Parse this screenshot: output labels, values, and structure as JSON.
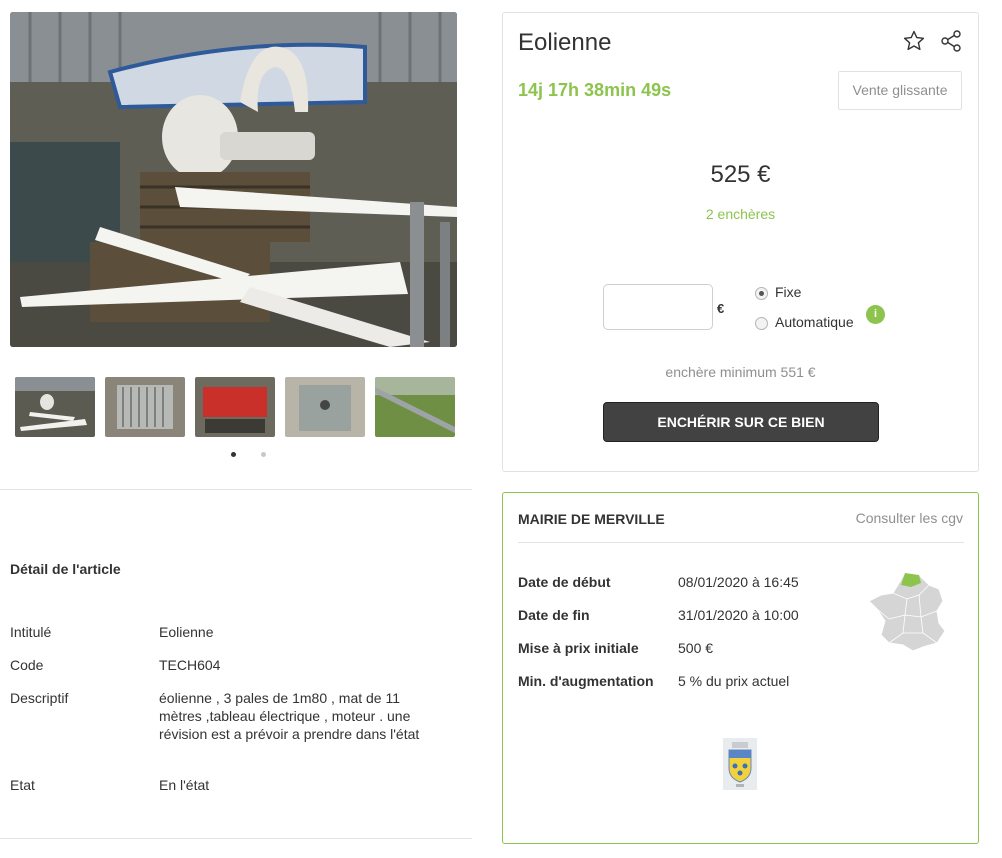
{
  "gallery": {
    "main_image_name": "wind-turbine-photo",
    "thumbnails": [
      "thumb-turbine-blades",
      "thumb-electrical-cabinet-grey",
      "thumb-red-cabinet",
      "thumb-control-box",
      "thumb-mast-in-grass"
    ],
    "active_index": 0
  },
  "auction": {
    "title": "Eolienne",
    "countdown": "14j 17h 38min 49s",
    "sale_type": "Vente glissante",
    "current_price": "525 €",
    "bid_count": "2 enchères",
    "bid_input_value": "",
    "currency_symbol": "€",
    "mode_options": [
      "Fixe",
      "Automatique"
    ],
    "selected_mode": "Fixe",
    "info_badge": "i",
    "min_bid": "enchère minimum 551 €",
    "bid_button": "ENCHÉRIR SUR CE BIEN",
    "icons": {
      "favorite": "star-icon",
      "share": "share-icon"
    },
    "colors": {
      "accent_green": "#8dc44e",
      "button_dark": "#424242"
    }
  },
  "details": {
    "section_title": "Détail de l'article",
    "rows": [
      {
        "label": "Intitulé",
        "value": "Eolienne"
      },
      {
        "label": "Code",
        "value": "TECH604"
      },
      {
        "label": "Descriptif",
        "value": "éolienne , 3 pales de 1m80 , mat de 11 mètres ,tableau électrique , moteur . une révision est a prévoir a prendre dans l'état"
      },
      {
        "label": "Etat",
        "value": "En l'état"
      }
    ]
  },
  "seller": {
    "name": "MAIRIE DE MERVILLE",
    "cgv_link": "Consulter les cgv",
    "rows": [
      {
        "label": "Date de début",
        "value": "08/01/2020 à 16:45"
      },
      {
        "label": "Date de fin",
        "value": "31/01/2020 à 10:00"
      },
      {
        "label": "Mise à prix initiale",
        "value": "500 €"
      },
      {
        "label": "Min. d'augmentation",
        "value": "5 % du prix actuel"
      }
    ],
    "map_icon": "france-region-map",
    "logo_icon": "merville-coat-of-arms"
  }
}
